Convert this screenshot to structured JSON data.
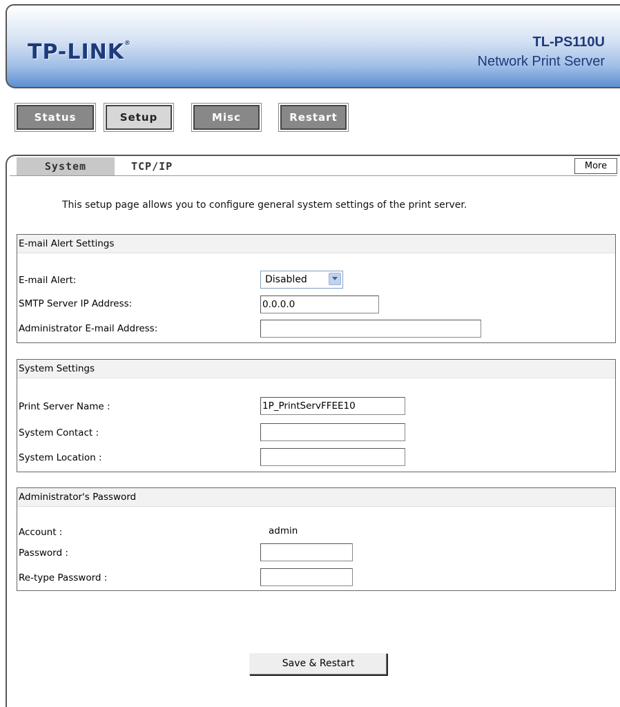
{
  "header": {
    "logo": "TP-LINK",
    "logo_mark": "®",
    "model": "TL-PS110U",
    "product": "Network Print Server"
  },
  "nav": {
    "status": "Status",
    "setup": "Setup",
    "misc": "Misc",
    "restart": "Restart"
  },
  "tabs": {
    "system": "System",
    "tcpip": "TCP/IP",
    "more": "More"
  },
  "intro": "This setup page allows you to configure general system settings of the print server.",
  "email_section": {
    "title": "E-mail Alert Settings",
    "alert_label": "E-mail Alert:",
    "alert_value": "Disabled",
    "smtp_label": "SMTP Server IP Address:",
    "smtp_value": "0.0.0.0",
    "admin_email_label": "Administrator E-mail Address:",
    "admin_email_value": ""
  },
  "system_section": {
    "title": "System Settings",
    "name_label": "Print Server Name :",
    "name_value": "1P_PrintServFFEE10",
    "contact_label": "System Contact :",
    "contact_value": "",
    "location_label": "System Location :",
    "location_value": ""
  },
  "password_section": {
    "title": "Administrator's Password",
    "account_label": "Account :",
    "account_value": "admin",
    "password_label": "Password :",
    "retype_label": "Re-type Password :"
  },
  "save_button": "Save & Restart"
}
